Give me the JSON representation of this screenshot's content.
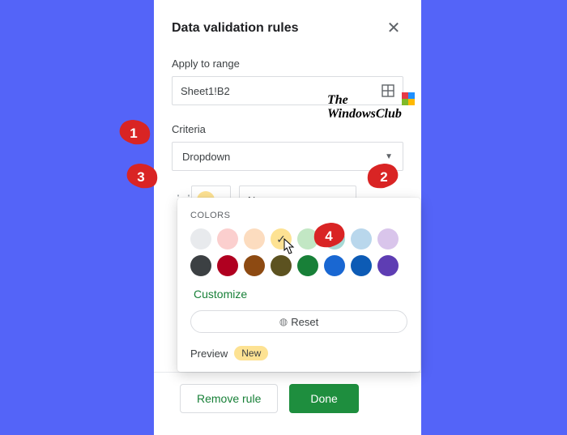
{
  "panel": {
    "title": "Data validation rules",
    "applyLabel": "Apply to range",
    "rangeValue": "Sheet1!B2",
    "criteriaLabel": "Criteria",
    "criteriaValue": "Dropdown",
    "option1Value": "New",
    "removeLabel": "Remove rule",
    "doneLabel": "Done"
  },
  "popover": {
    "label": "COLORS",
    "customize": "Customize",
    "reset": "Reset",
    "previewLabel": "Preview",
    "previewBadge": "New",
    "swatches": [
      {
        "c": "#e8eaed",
        "sel": false
      },
      {
        "c": "#fbcfce",
        "sel": false
      },
      {
        "c": "#fcdcbf",
        "sel": false
      },
      {
        "c": "#fde293",
        "sel": true
      },
      {
        "c": "#c2e7c4",
        "sel": false
      },
      {
        "c": "#a7d9d5",
        "sel": false
      },
      {
        "c": "#b9d7ec",
        "sel": false
      },
      {
        "c": "#d9c5eb",
        "sel": false
      },
      {
        "c": "#3c4043",
        "sel": false
      },
      {
        "c": "#b00020",
        "sel": false
      },
      {
        "c": "#8d4a12",
        "sel": false
      },
      {
        "c": "#5c5220",
        "sel": false
      },
      {
        "c": "#188038",
        "sel": false
      },
      {
        "c": "#1967d2",
        "sel": false
      },
      {
        "c": "#0d5bb5",
        "sel": false
      },
      {
        "c": "#5e3db3",
        "sel": false
      }
    ]
  },
  "watermark": {
    "line1": "The",
    "line2": "WindowsClub"
  },
  "callouts": {
    "c1": "1",
    "c2": "2",
    "c3": "3",
    "c4": "4"
  }
}
